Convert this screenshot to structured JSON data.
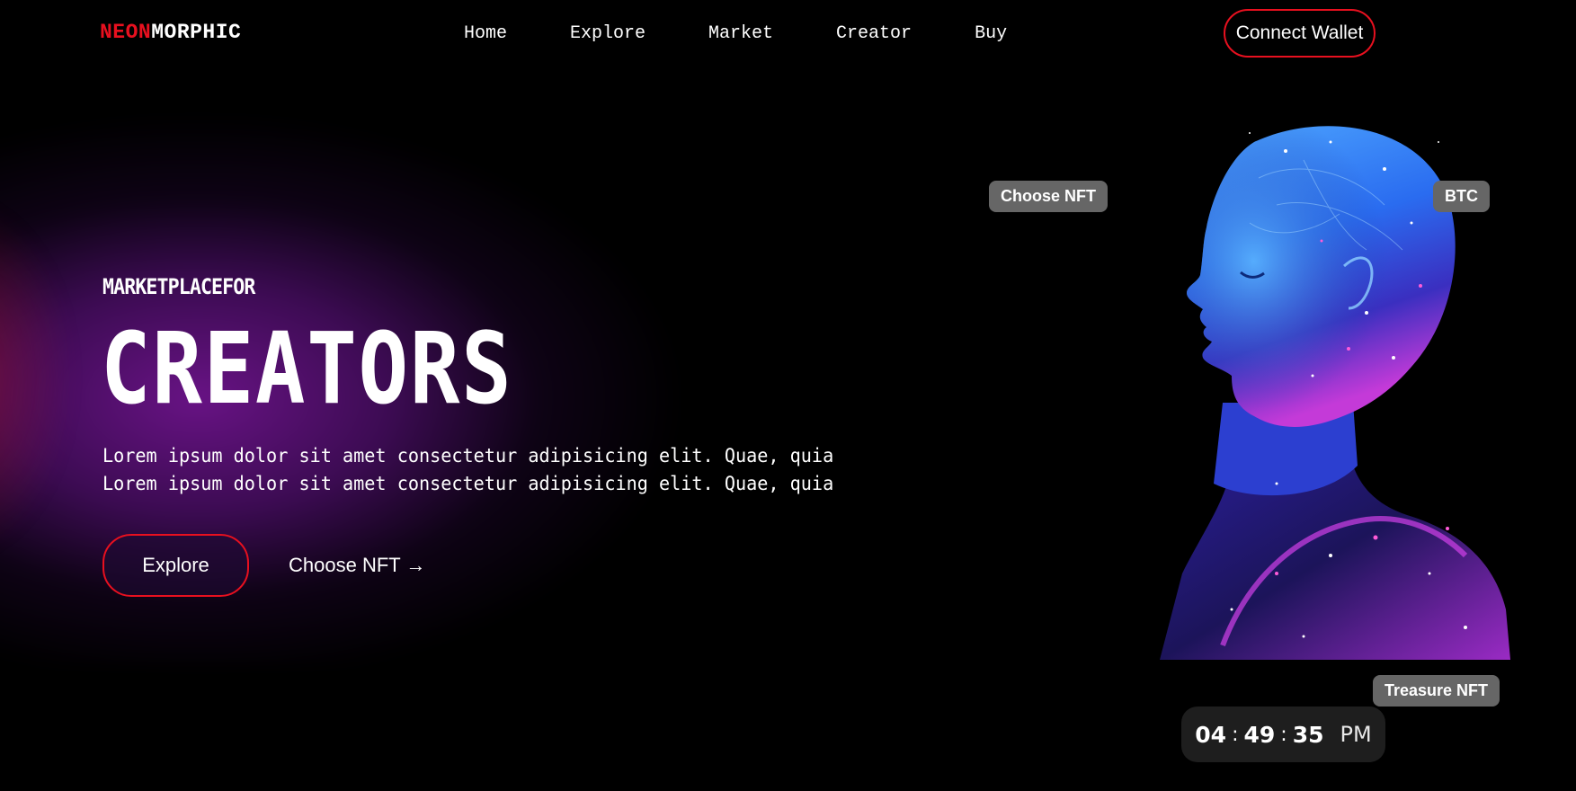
{
  "brand": {
    "part1": "NEON",
    "part2": "MORPHIC"
  },
  "nav": {
    "items": [
      {
        "label": "Home"
      },
      {
        "label": "Explore"
      },
      {
        "label": "Market"
      },
      {
        "label": "Creator"
      },
      {
        "label": "Buy"
      }
    ],
    "connect_label": "Connect Wallet"
  },
  "hero": {
    "subtitle": "MARKETPLACEFOR",
    "title": "CREATORS",
    "desc_line1": "Lorem ipsum dolor sit amet consectetur adipisicing elit. Quae, quia",
    "desc_line2": "Lorem ipsum dolor sit amet consectetur adipisicing elit. Quae, quia",
    "explore_label": "Explore",
    "choose_label": "Choose NFT →"
  },
  "visual": {
    "image_name": "cosmic-head-illustration",
    "tag_choose": "Choose NFT",
    "tag_btc": "BTC",
    "tag_treasure": "Treasure NFT"
  },
  "clock": {
    "hours": "04",
    "minutes": "49",
    "seconds": "35",
    "sep": ":",
    "ampm": "PM"
  },
  "colors": {
    "accent": "#e8101f",
    "background": "#000000",
    "glow_purple": "#6e148c",
    "head_blue": "#2a6cf0",
    "head_magenta": "#c43ad8",
    "pill_gray": "#666666",
    "clock_bg": "#1e1e1e"
  }
}
